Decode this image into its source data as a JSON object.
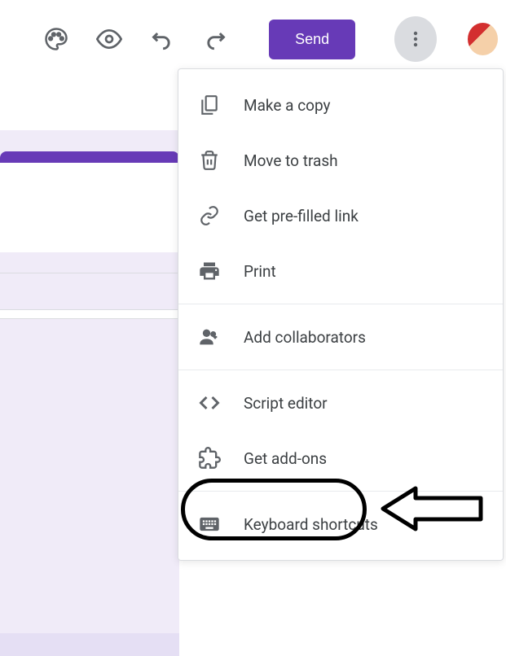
{
  "toolbar": {
    "send_label": "Send"
  },
  "menu": {
    "items": [
      {
        "label": "Make a copy"
      },
      {
        "label": "Move to trash"
      },
      {
        "label": "Get pre-filled link"
      },
      {
        "label": "Print"
      },
      {
        "label": "Add collaborators"
      },
      {
        "label": "Script editor"
      },
      {
        "label": "Get add-ons"
      },
      {
        "label": "Keyboard shortcuts"
      }
    ]
  }
}
